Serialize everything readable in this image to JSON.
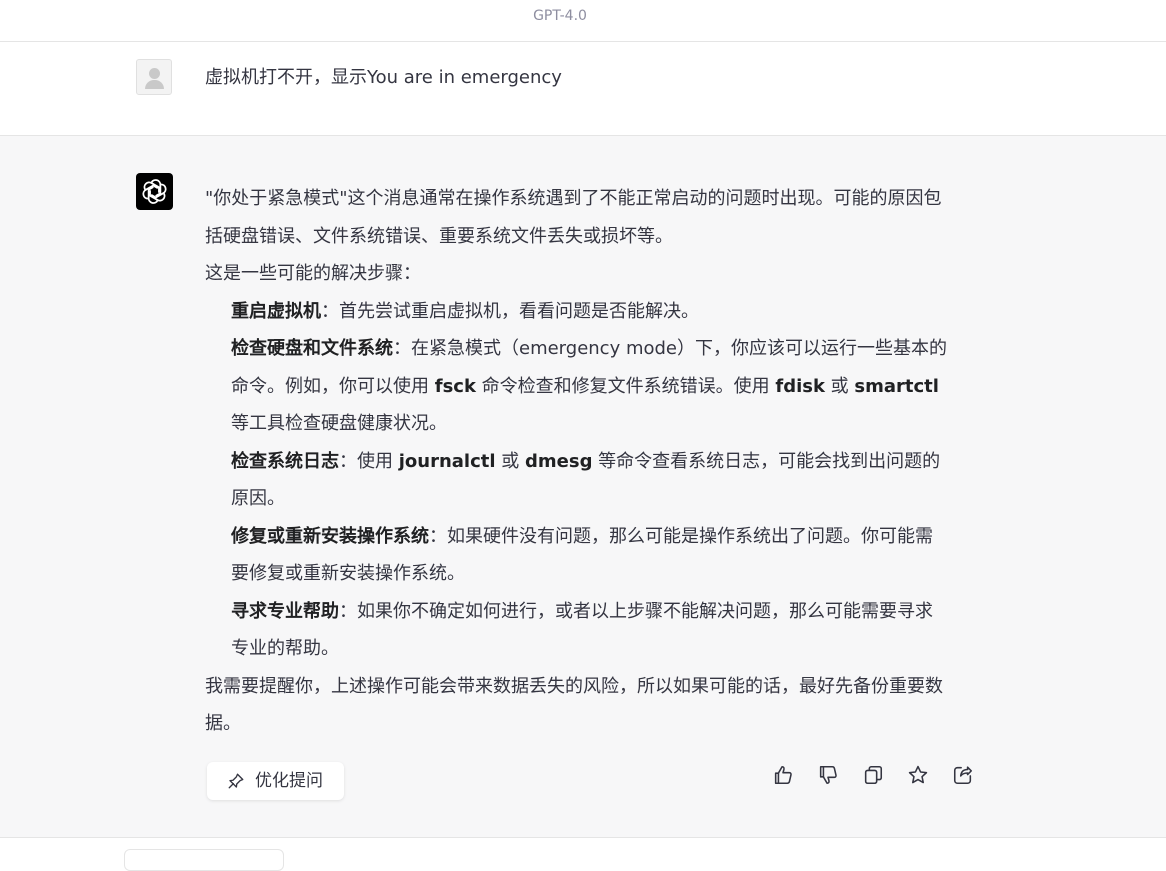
{
  "header": {
    "model": "GPT-4.0"
  },
  "user_message": {
    "text": "虚拟机打不开，显示You are in emergency"
  },
  "assistant_message": {
    "intro_lines": [
      "\"你处于紧急模式\"这个消息通常在操作系统遇到了不能正常启动的问题时出现。可能的原因包括硬盘错误、文件系统错误、重要系统文件丢失或损坏等。"
    ],
    "steps_intro": "这是一些可能的解决步骤：",
    "steps": [
      {
        "title": "重启虚拟机",
        "text": "：首先尝试重启虚拟机，看看问题是否能解决。"
      },
      {
        "title": "检查硬盘和文件系统",
        "text_a": "：在紧急模式（emergency mode）下，你应该可以运行一些基本的命令。例如，你可以使用 ",
        "code_a": "fsck",
        "text_b": " 命令检查和修复文件系统错误。使用 ",
        "code_b": "fdisk",
        "text_c": " 或 ",
        "code_c": "smartctl",
        "text_d": " 等工具检查硬盘健康状况。"
      },
      {
        "title": "检查系统日志",
        "text_a": "：使用 ",
        "code_a": "journalctl",
        "text_b": " 或 ",
        "code_b": "dmesg",
        "text_c": " 等命令查看系统日志，可能会找到出问题的原因。"
      },
      {
        "title": "修复或重新安装操作系统",
        "text": "：如果硬件没有问题，那么可能是操作系统出了问题。你可能需要修复或重新安装操作系统。"
      },
      {
        "title": "寻求专业帮助",
        "text": "：如果你不确定如何进行，或者以上步骤不能解决问题，那么可能需要寻求专业的帮助。"
      }
    ],
    "outro": "我需要提醒你，上述操作可能会带来数据丢失的风险，所以如果可能的话，最好先备份重要数据。"
  },
  "toolbar": {
    "optimize_label": "优化提问",
    "icons": [
      "thumbs-up-icon",
      "thumbs-down-icon",
      "copy-icon",
      "star-icon",
      "share-icon"
    ]
  },
  "colors": {
    "assistant_bg": "#f7f7f8",
    "text": "#343541",
    "avatar_bg": "#000000"
  }
}
